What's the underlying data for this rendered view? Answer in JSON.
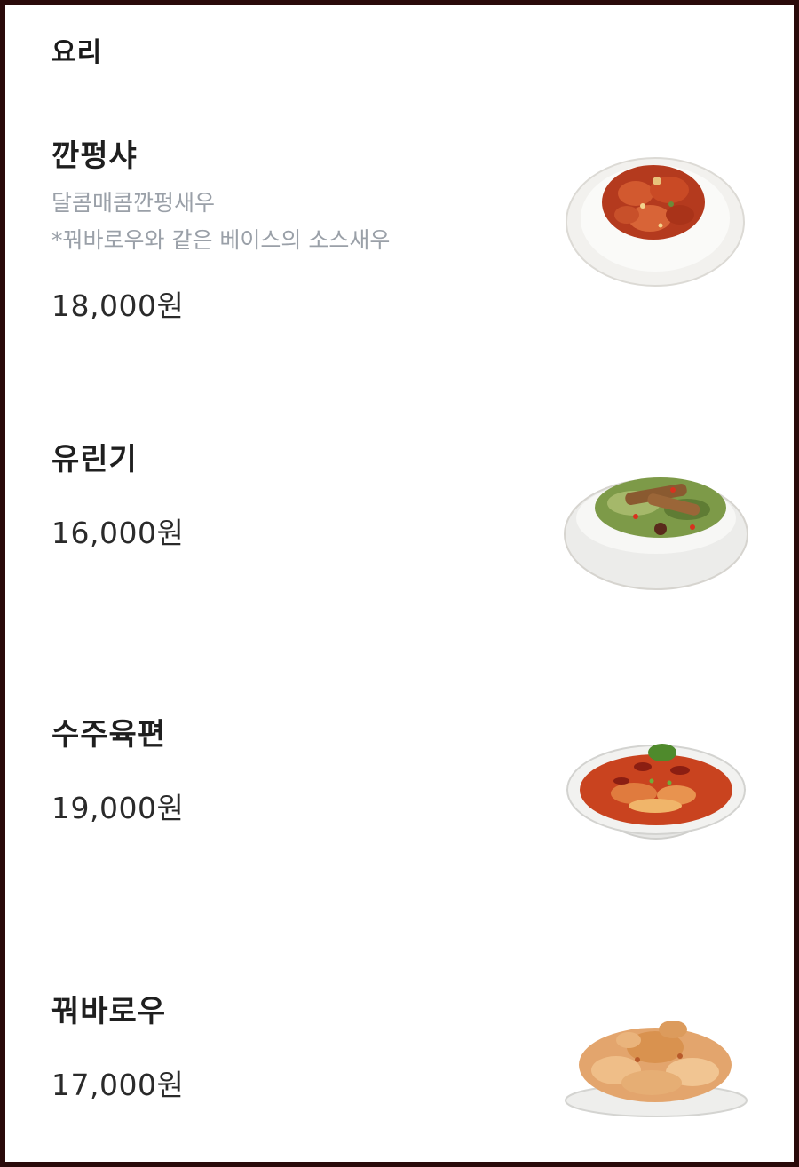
{
  "section": {
    "title": "요리"
  },
  "items": [
    {
      "name": "깐펑샤",
      "description_lines": [
        "달콤매콤깐펑새우",
        "*꿔바로우와 같은 베이스의 소스새우"
      ],
      "price": "18,000원",
      "image_icon": "kanpung-shrimp-dish-image"
    },
    {
      "name": "유린기",
      "price": "16,000원",
      "image_icon": "yuringi-dish-image"
    },
    {
      "name": "수주육편",
      "price": "19,000원",
      "image_icon": "suzhu-yukpyeon-dish-image"
    },
    {
      "name": "꿔바로우",
      "price": "17,000원",
      "image_icon": "guobaorou-dish-image"
    }
  ],
  "colors": {
    "frame": "#2a0a0a",
    "background": "#ffffff",
    "name_text": "#1f1f1f",
    "description_text": "#9aa0a8",
    "price_text": "#2a2a2a"
  }
}
